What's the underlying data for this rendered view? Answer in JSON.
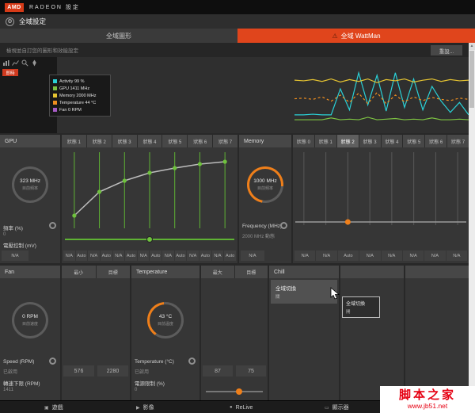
{
  "titlebar": {
    "logo": "AMD",
    "app_name": "RADEON 設定"
  },
  "header": {
    "title": "全域設定"
  },
  "tabs": {
    "graphics": "全域圖形",
    "wattman": "全域 WattMan"
  },
  "subheader": {
    "hint": "檢視並自訂您的圖形和效能設定",
    "reset_button": "重設..."
  },
  "monitor": {
    "badge": "即時",
    "legend": [
      {
        "color": "#2ad0d6",
        "label": "Activity 99 %"
      },
      {
        "color": "#7dc242",
        "label": "GPU 1411 MHz"
      },
      {
        "color": "#e6c431",
        "label": "Memory 2000 MHz"
      },
      {
        "color": "#ef8e1f",
        "label": "Temperature 44 °C"
      },
      {
        "color": "#a85cc7",
        "label": "Fan 0 RPM"
      }
    ],
    "chart": {
      "series": [
        {
          "name": "activity",
          "color": "#2ad0d6",
          "dash": false,
          "points": [
            78,
            78,
            77,
            78,
            78,
            36,
            70,
            10,
            62,
            14,
            72,
            10,
            66,
            20,
            70,
            32,
            56,
            74,
            58,
            78
          ]
        },
        {
          "name": "memory",
          "color": "#e6c431",
          "dash": false,
          "points": [
            22,
            23,
            21,
            24,
            20,
            25,
            21,
            24,
            20,
            26,
            21,
            23,
            20,
            25,
            22,
            20,
            24,
            21,
            23,
            22
          ]
        },
        {
          "name": "temperature",
          "color": "#ef8e1f",
          "dash": true,
          "points": [
            52,
            51,
            53,
            49,
            56,
            46,
            58,
            43,
            60,
            42,
            60,
            46,
            57,
            49,
            55,
            50,
            53,
            55,
            51,
            53
          ]
        },
        {
          "name": "gpu",
          "color": "#7dc242",
          "dash": false,
          "points": [
            86,
            86,
            86,
            86,
            83,
            86,
            85,
            86,
            82,
            86,
            85,
            84,
            86,
            85,
            86,
            83,
            86,
            86,
            85,
            86
          ]
        }
      ]
    }
  },
  "gpu": {
    "title": "GPU",
    "gauge_value": "323 MHz",
    "gauge_caption": "目前頻率",
    "freq_label": "頻率 (%)",
    "freq_value": "0",
    "voltage_label": "電壓控制 (mV)",
    "voltage_value": "N/A",
    "states": {
      "headers": [
        "狀態 1",
        "狀態 2",
        "狀態 3",
        "狀態 4",
        "狀態 5",
        "狀態 6",
        "狀態 7"
      ],
      "curve": [
        84,
        54,
        40,
        30,
        24,
        19,
        16
      ],
      "values": [
        "N/A",
        "Auto",
        "N/A",
        "Auto",
        "N/A",
        "Auto",
        "N/A",
        "Auto",
        "N/A",
        "Auto",
        "N/A",
        "Auto",
        "N/A",
        "Auto"
      ]
    }
  },
  "memory": {
    "title": "Memory",
    "gauge_value": "1000 MHz",
    "gauge_caption": "目前頻率",
    "freq_label": "Frequency (MHz)",
    "freq_value": "2000 MHz 動態",
    "na_value": "N/A",
    "states": {
      "headers": [
        "狀態 0",
        "狀態 1",
        "狀態 2",
        "狀態 3",
        "狀態 4",
        "狀態 5",
        "狀態 6",
        "狀態 7"
      ],
      "active_index": 2,
      "values": [
        "N/A",
        "N/A",
        "Auto",
        "N/A",
        "N/A",
        "N/A",
        "N/A",
        "N/A"
      ]
    }
  },
  "fan": {
    "title": "Fan",
    "gauge_value": "0 RPM",
    "gauge_caption": "目前速度",
    "speed_label": "Speed (RPM)",
    "speed_state": "已啟用",
    "min_label": "轉速下限 (RPM)",
    "min_value": "1411",
    "columns": {
      "headers": [
        "最小",
        "目標"
      ],
      "values": [
        "576",
        "2280"
      ]
    }
  },
  "temperature": {
    "title": "Temperature",
    "gauge_value": "43 °C",
    "gauge_caption": "目前溫度",
    "temp_label": "Temperature (°C)",
    "temp_state": "已啟用",
    "power_label": "電源限制 (%)",
    "power_value": "0",
    "columns": {
      "headers": [
        "最大",
        "目標"
      ],
      "values": [
        "87",
        "75"
      ]
    }
  },
  "chill": {
    "title": "Chill",
    "toggle_label": "全域切換",
    "toggle_value": "關",
    "tooltip_label": "全域切換",
    "tooltip_value": "開"
  },
  "taskbar": {
    "items": [
      {
        "id": "gaming",
        "icon": "▣",
        "label": "遊戲"
      },
      {
        "id": "video",
        "icon": "▶",
        "label": "影像"
      },
      {
        "id": "relive",
        "icon": "●",
        "label": "ReLive"
      },
      {
        "id": "display",
        "icon": "▭",
        "label": "顯示器"
      }
    ]
  },
  "watermark": {
    "title": "脚本之家",
    "url": "www.jb51.net"
  }
}
